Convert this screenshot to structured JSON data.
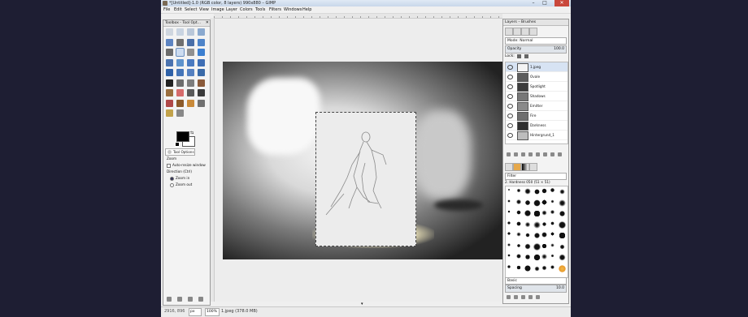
{
  "window": {
    "title": "*[Untitled]-1.0 (RGB color, 8 layers) 990x880 – GIMP",
    "min_label": "–",
    "max_label": "□",
    "close_label": "✕"
  },
  "menu": [
    "File",
    "Edit",
    "Select",
    "View",
    "Image",
    "Layer",
    "Colors",
    "Tools",
    "Filters",
    "Windows",
    "Help"
  ],
  "toolbox": {
    "title": "Toolbox - Tool Opt...",
    "close": "✕",
    "tools": [
      "rect-select-icon",
      "ellipse-select-icon",
      "free-select-icon",
      "fuzzy-select-icon",
      "color-select-icon",
      "scissors-icon",
      "foreground-select-icon",
      "paths-icon",
      "color-picker-icon",
      "zoom-icon",
      "measure-icon",
      "move-icon",
      "align-icon",
      "crop-icon",
      "rotate-icon",
      "scale-icon",
      "shear-icon",
      "perspective-icon",
      "flip-icon",
      "cage-icon",
      "text-icon",
      "bucket-fill-icon",
      "blend-icon",
      "pencil-icon",
      "paintbrush-icon",
      "eraser-icon",
      "airbrush-icon",
      "ink-icon",
      "clone-icon",
      "heal-icon",
      "perspective-clone-icon",
      "smudge-icon",
      "blur-icon",
      "dodge-burn-icon"
    ],
    "selected_tool_index": 9,
    "options_tab": "Tool Options",
    "options": {
      "zoom_heading": "Zoom",
      "auto_resize": "Auto-resize window",
      "direction_heading": "Direction  (Ctrl)",
      "zoom_in": "Zoom in",
      "zoom_out": "Zoom out"
    }
  },
  "statusbar": {
    "coords": "2916, 896",
    "unit": "px",
    "zoom": "100%",
    "info": "1.jpeg (378.0 MB)"
  },
  "layers_dock": {
    "title": "Layers – Brushes",
    "mode": "Mode: Normal",
    "opacity_label": "Opacity",
    "opacity_value": "100.0",
    "lock_label": "Lock:",
    "layers": [
      {
        "name": "1.jpeg",
        "thumb": "#f4f4f4"
      },
      {
        "name": "Ovale",
        "thumb": "#5c5c5c"
      },
      {
        "name": "Spotlight",
        "thumb": "#3c3c3c"
      },
      {
        "name": "Shadows",
        "thumb": "#777777"
      },
      {
        "name": "Emitter",
        "thumb": "#8a8a8a"
      },
      {
        "name": "Fire",
        "thumb": "#6e6e6e"
      },
      {
        "name": "Darkness",
        "thumb": "#2f2f2f"
      },
      {
        "name": "Hintergrund_1",
        "thumb": "#bdbdbd"
      }
    ],
    "brush_tag": "Filter",
    "brush_name": "2. Hardness 050 (51 × 51)",
    "brush_preset": "Basic",
    "spacing_label": "Spacing",
    "spacing_value": "10.0"
  },
  "colors": {
    "accent": "#6b8fbf",
    "foreground": "#000000",
    "background": "#ffffff"
  }
}
